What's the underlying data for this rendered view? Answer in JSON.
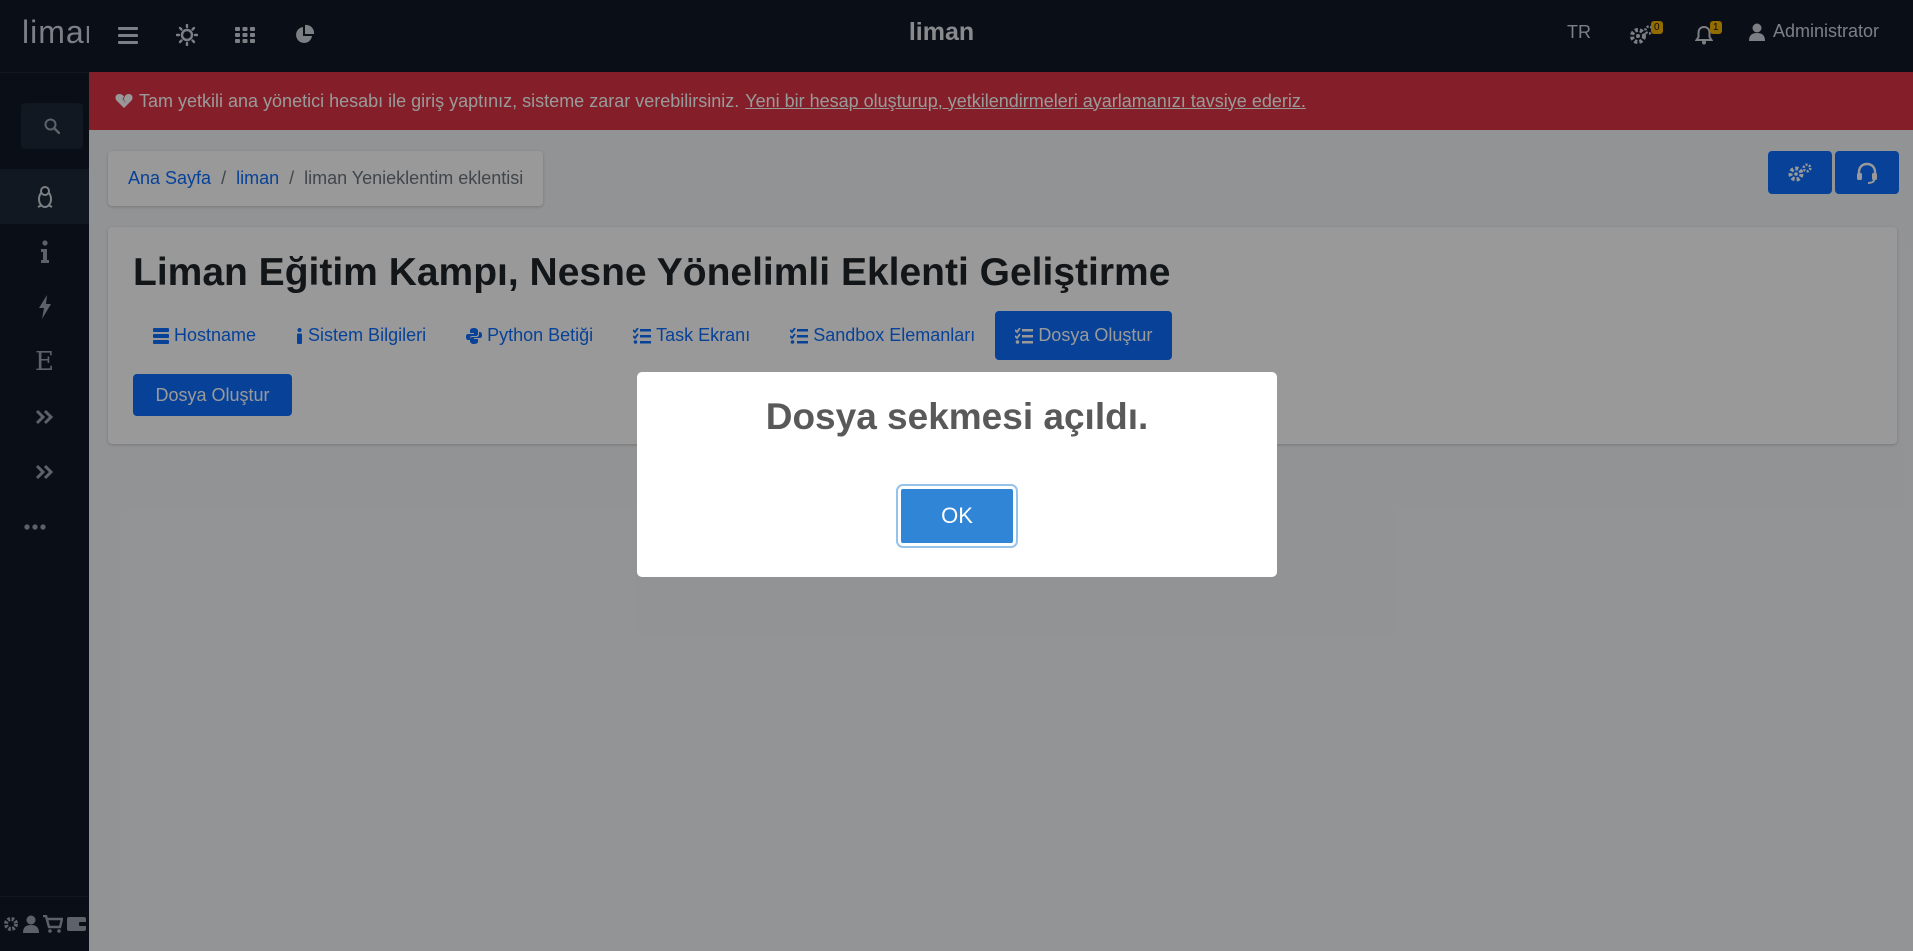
{
  "navbar": {
    "brand": "liman",
    "title": "liman",
    "language": "TR",
    "settings_badge": "0",
    "notifications_badge": "1",
    "user_name": "Administrator",
    "icons": [
      "bars-icon",
      "sun-icon",
      "grid-icon",
      "pie-chart-icon",
      "gears-icon",
      "bell-icon",
      "user-icon"
    ]
  },
  "sidebar": {
    "items": [
      {
        "icon": "linux-icon",
        "active": true
      },
      {
        "icon": "info-icon"
      },
      {
        "icon": "bolt-icon"
      },
      {
        "icon": "letter-e-icon",
        "glyph": "E"
      },
      {
        "icon": "double-chevron-icon"
      },
      {
        "icon": "double-chevron-icon"
      },
      {
        "icon": "ellipsis-icon"
      }
    ],
    "bottom_icons": [
      "gear-icon",
      "user-icon",
      "cart-icon",
      "wallet-icon"
    ]
  },
  "alert": {
    "text": "Tam yetkili ana yönetici hesabı ile giriş yaptınız, sisteme zarar verebilirsiniz.",
    "link": "Yeni bir hesap oluşturup, yetkilendirmeleri ayarlamanızı tavsiye ederiz."
  },
  "breadcrumb": {
    "home": "Ana Sayfa",
    "server": "liman",
    "current": "liman Yenieklentim eklentisi",
    "separator": "/"
  },
  "page": {
    "title": "Liman Eğitim Kampı, Nesne Yönelimli Eklenti Geliştirme",
    "tabs": [
      {
        "label": "Hostname",
        "icon": "server-icon"
      },
      {
        "label": "Sistem Bilgileri",
        "icon": "info-icon"
      },
      {
        "label": "Python Betiği",
        "icon": "python-icon"
      },
      {
        "label": "Task Ekranı",
        "icon": "tasks-icon"
      },
      {
        "label": "Sandbox Elemanları",
        "icon": "tasks-icon"
      },
      {
        "label": "Dosya Oluştur",
        "icon": "tasks-icon",
        "active": true
      }
    ],
    "create_button": "Dosya Oluştur"
  },
  "modal": {
    "title": "Dosya sekmesi açıldı.",
    "ok_label": "OK"
  },
  "colors": {
    "primary": "#0d6efd",
    "danger": "#dc3545",
    "dark": "#111827",
    "modal_button": "#3085d6"
  }
}
